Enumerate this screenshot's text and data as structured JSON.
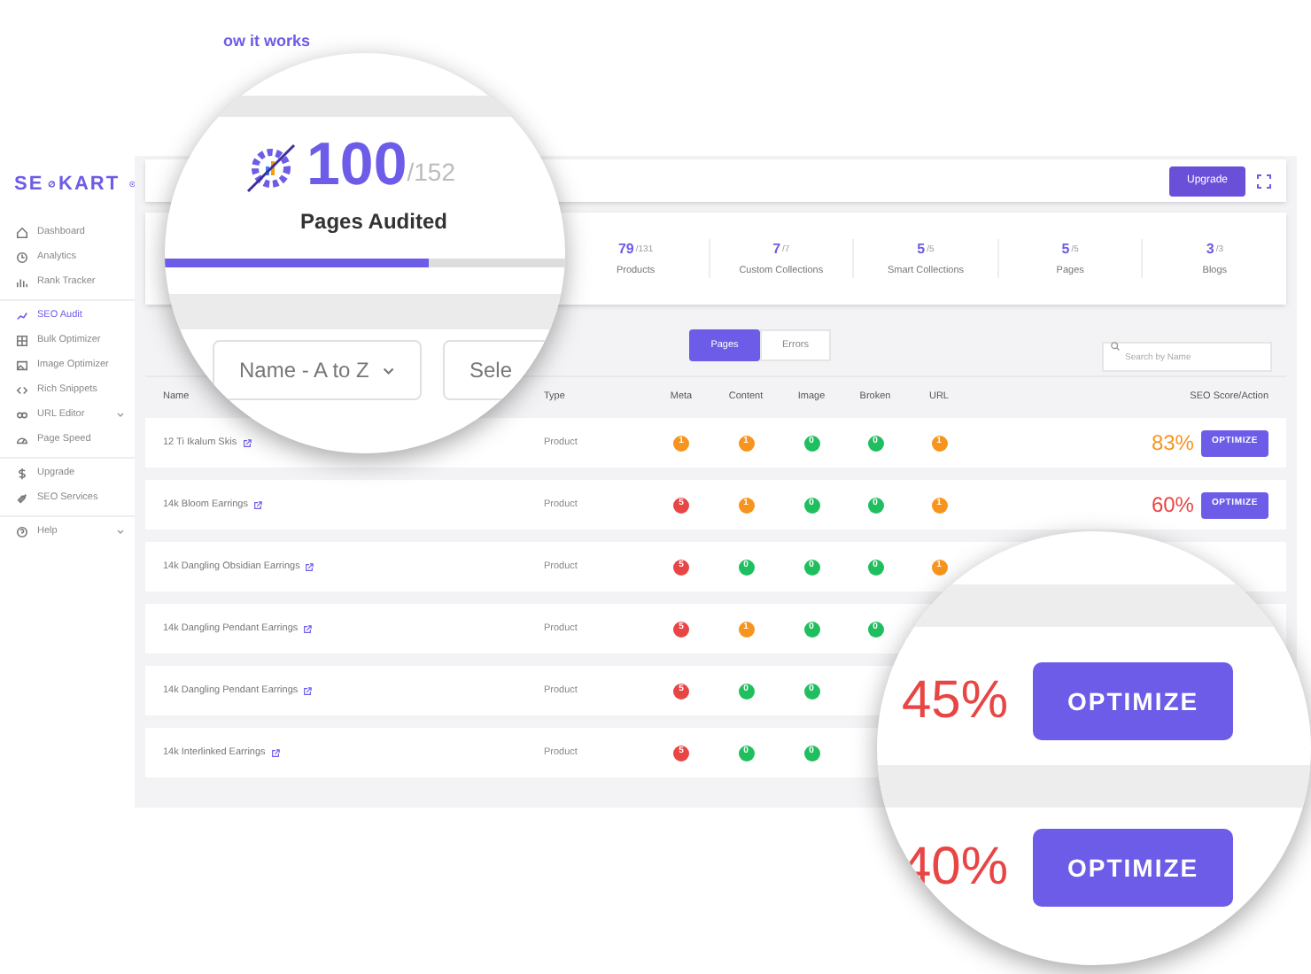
{
  "header_link": "ow it works",
  "brand": {
    "logo_parts": [
      "SE",
      "KART"
    ]
  },
  "sidebar": {
    "groups": [
      {
        "items": [
          {
            "label": "Dashboard",
            "selected": false,
            "expandable": false
          },
          {
            "label": "Analytics",
            "selected": false,
            "expandable": false
          },
          {
            "label": "Rank Tracker",
            "selected": false,
            "expandable": false
          }
        ]
      },
      {
        "items": [
          {
            "label": "SEO Audit",
            "selected": true,
            "expandable": false
          },
          {
            "label": "Bulk Optimizer",
            "selected": false,
            "expandable": false
          },
          {
            "label": "Image Optimizer",
            "selected": false,
            "expandable": false
          },
          {
            "label": "Rich Snippets",
            "selected": false,
            "expandable": false
          },
          {
            "label": "URL Editor",
            "selected": false,
            "expandable": true
          },
          {
            "label": "Page Speed",
            "selected": false,
            "expandable": false
          }
        ]
      },
      {
        "items": [
          {
            "label": "Upgrade",
            "selected": false,
            "expandable": false
          },
          {
            "label": "SEO Services",
            "selected": false,
            "expandable": false
          }
        ]
      },
      {
        "items": [
          {
            "label": "Help",
            "selected": false,
            "expandable": true
          }
        ]
      }
    ]
  },
  "upgrade_button": "Upgrade",
  "stats": [
    {
      "value": "79",
      "total": "/131",
      "label": "Products"
    },
    {
      "value": "7",
      "total": "/7",
      "label": "Custom Collections"
    },
    {
      "value": "5",
      "total": "/5",
      "label": "Smart Collections"
    },
    {
      "value": "5",
      "total": "/5",
      "label": "Pages"
    },
    {
      "value": "3",
      "total": "/3",
      "label": "Blogs"
    }
  ],
  "tabs": [
    {
      "label": "Pages",
      "selected": true
    },
    {
      "label": "Errors",
      "selected": false
    }
  ],
  "search": {
    "placeholder": "Search by Name"
  },
  "table": {
    "columns": [
      "Name",
      "Type",
      "Meta",
      "Content",
      "Image",
      "Broken",
      "URL",
      "SEO Score/Action"
    ],
    "rows": [
      {
        "name": "12 Ti Ikalum Skis",
        "type": "Product",
        "badges": [
          {
            "value": "1",
            "color": "#f7941d"
          },
          {
            "value": "1",
            "color": "#f7941d"
          },
          {
            "value": "0",
            "color": "#1fbf5f"
          },
          {
            "value": "0",
            "color": "#1fbf5f"
          },
          {
            "value": "1",
            "color": "#f7941d"
          }
        ],
        "score": "83%",
        "color": "#f7941d",
        "action": "OPTIMIZE"
      },
      {
        "name": "14k Bloom Earrings",
        "type": "Product",
        "badges": [
          {
            "value": "5",
            "color": "#e84545"
          },
          {
            "value": "1",
            "color": "#f7941d"
          },
          {
            "value": "0",
            "color": "#1fbf5f"
          },
          {
            "value": "0",
            "color": "#1fbf5f"
          },
          {
            "value": "1",
            "color": "#f7941d"
          }
        ],
        "score": "60%",
        "color": "#e84545",
        "action": "OPTIMIZE"
      },
      {
        "name": "14k Dangling Obsidian Earrings",
        "type": "Product",
        "badges": [
          {
            "value": "5",
            "color": "#e84545"
          },
          {
            "value": "0",
            "color": "#1fbf5f"
          },
          {
            "value": "0",
            "color": "#1fbf5f"
          },
          {
            "value": "0",
            "color": "#1fbf5f"
          },
          {
            "value": "1",
            "color": "#f7941d"
          }
        ]
      },
      {
        "name": "14k Dangling Pendant Earrings",
        "type": "Product",
        "badges": [
          {
            "value": "5",
            "color": "#e84545"
          },
          {
            "value": "1",
            "color": "#f7941d"
          },
          {
            "value": "0",
            "color": "#1fbf5f"
          },
          {
            "value": "0",
            "color": "#1fbf5f"
          }
        ]
      },
      {
        "name": "14k Dangling Pendant Earrings",
        "type": "Product",
        "badges": [
          {
            "value": "5",
            "color": "#e84545"
          },
          {
            "value": "0",
            "color": "#1fbf5f"
          },
          {
            "value": "0",
            "color": "#1fbf5f"
          }
        ]
      },
      {
        "name": "14k Interlinked Earrings",
        "type": "Product",
        "badges": [
          {
            "value": "5",
            "color": "#e84545"
          },
          {
            "value": "0",
            "color": "#1fbf5f"
          },
          {
            "value": "0",
            "color": "#1fbf5f"
          }
        ]
      }
    ]
  },
  "magnifier_stats": {
    "value": "100",
    "total": "/152",
    "label": "Pages Audited",
    "level": 0.66,
    "sort_dropdown": "Name - A to Z",
    "filter_dropdown": "Sele"
  },
  "magnifier_scores": {
    "rows": [
      {
        "score": "45%",
        "color": "#e84545",
        "action": "OPTIMIZE"
      },
      {
        "score": "40%",
        "color": "#e84545",
        "action": "OPTIMIZE"
      }
    ]
  }
}
